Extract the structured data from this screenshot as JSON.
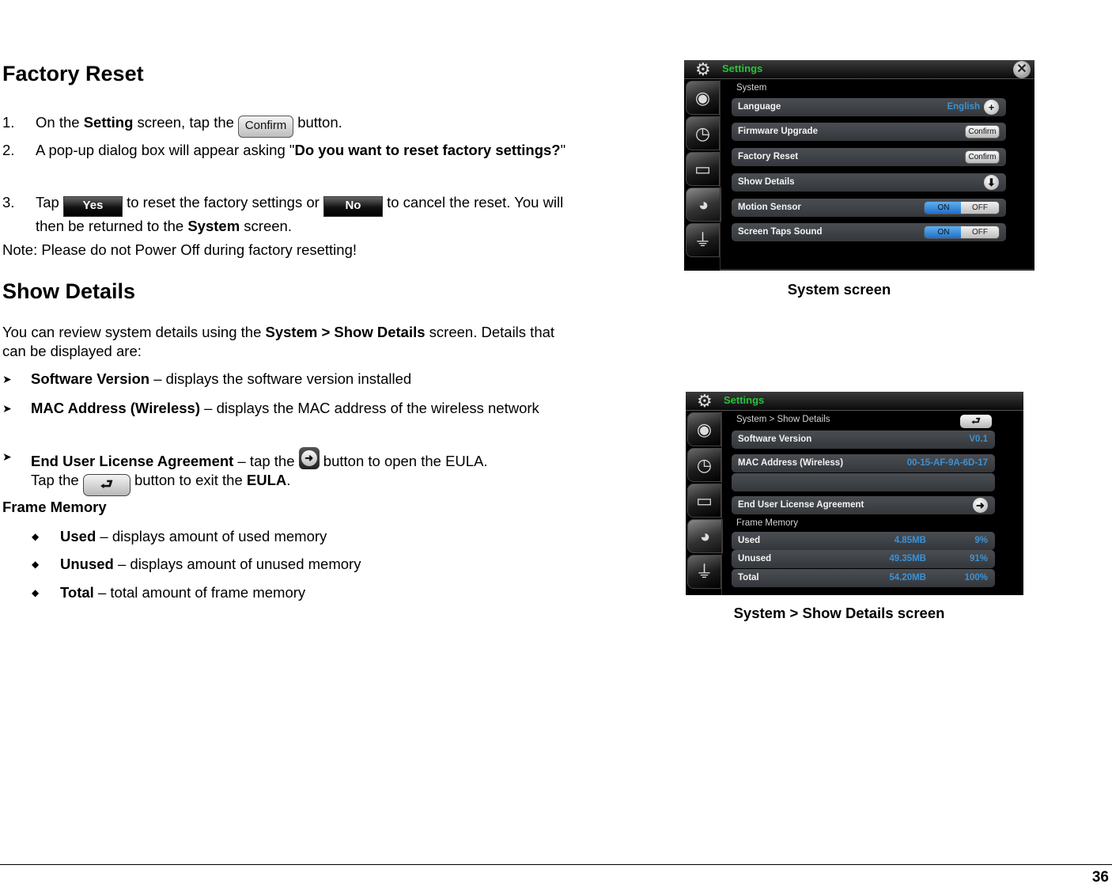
{
  "factory_reset": {
    "heading": "Factory Reset",
    "steps": [
      {
        "num": "1.",
        "pre": "On the ",
        "bold": "Setting",
        "mid": " screen, tap the ",
        "button": "Confirm",
        "post": " button."
      },
      {
        "num": "2.",
        "pre": "A pop-up dialog box will appear asking \"",
        "bold": "Do you want to reset factory settings?",
        "post": "\""
      },
      {
        "num": "3.",
        "pre": "Tap ",
        "button_yes": "Yes",
        "mid1": " to reset the factory settings or ",
        "button_no": "No",
        "mid2": " to cancel the reset.  You will then be returned to the ",
        "bold": "System",
        "post": " screen."
      }
    ],
    "note": "Note: Please do not Power Off during factory resetting!"
  },
  "show_details": {
    "heading": "Show Details",
    "intro_pre": "You can review system details using the ",
    "intro_bold": "System > Show Details",
    "intro_post": " screen.  Details that can be displayed are:",
    "bullet_glyph": "➤",
    "bullets": [
      {
        "bold": "Software Version",
        "text": " – displays the software version installed"
      },
      {
        "bold": "MAC Address (Wireless)",
        "text": " – displays the MAC address of the wireless network"
      },
      {
        "bold": "End User License Agreement",
        "text1": " – tap the ",
        "text2": " button to open the EULA.",
        "line2_pre": "Tap the ",
        "line2_mid": " button to exit the ",
        "line2_bold": "EULA",
        "line2_post": "."
      }
    ],
    "frame_memory_heading": "Frame Memory",
    "diamond_glyph": "◆",
    "frame_items": [
      {
        "bold": "Used",
        "text": " – displays amount of used memory"
      },
      {
        "bold": "Unused",
        "text": " – displays amount of unused memory"
      },
      {
        "bold": "Total",
        "text": " – total amount of frame memory"
      }
    ]
  },
  "system_screen": {
    "title": "Settings",
    "section": "System",
    "rows": [
      {
        "label": "Language",
        "value": "English",
        "control": "+"
      },
      {
        "label": "Firmware Upgrade",
        "control": "Confirm"
      },
      {
        "label": "Factory Reset",
        "control": "Confirm"
      },
      {
        "label": "Show Details",
        "control": "⬇"
      },
      {
        "label": "Motion Sensor",
        "on": "ON",
        "off": "OFF",
        "state": "ON"
      },
      {
        "label": "Screen Taps Sound",
        "on": "ON",
        "off": "OFF",
        "state": "ON"
      }
    ],
    "caption": "System screen"
  },
  "details_screen": {
    "title": "Settings",
    "breadcrumb": "System > Show Details",
    "back_glyph": "⮐",
    "rows": [
      {
        "label": "Software Version",
        "value": "V0.1"
      },
      {
        "label": "MAC Address (Wireless)",
        "value": "00-15-AF-9A-6D-17"
      },
      {
        "label": "",
        "value": ""
      },
      {
        "label": "End User License Agreement",
        "control": "➜"
      }
    ],
    "frame_memory_heading": "Frame Memory",
    "memory": [
      {
        "label": "Used",
        "size": "4.85MB",
        "percent": "9%"
      },
      {
        "label": "Unused",
        "size": "49.35MB",
        "percent": "91%"
      },
      {
        "label": "Total",
        "size": "54.20MB",
        "percent": "100%"
      }
    ],
    "caption": "System > Show Details screen"
  },
  "side_tab_icons": [
    "globe-wifi",
    "clock",
    "display",
    "pie-chart",
    "power-plug"
  ],
  "page_number": "36",
  "colors": {
    "title_green": "#27c43a",
    "value_blue": "#3b92d6",
    "toggle_on": "#1f6fc7"
  }
}
